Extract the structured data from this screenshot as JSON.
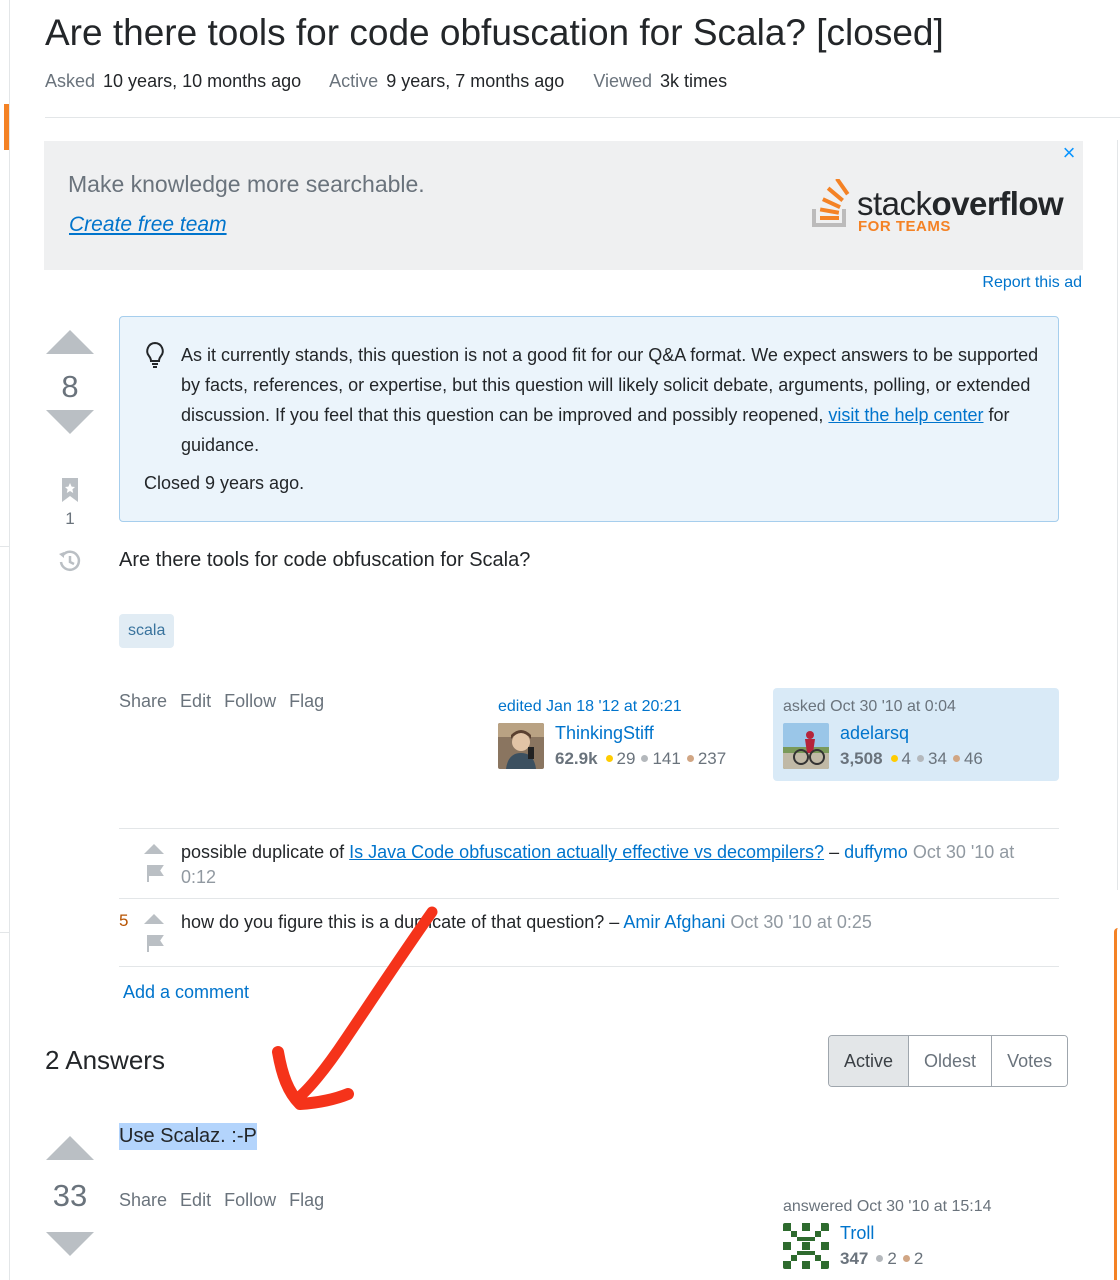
{
  "question": {
    "title": "Are there tools for code obfuscation for Scala? [closed]",
    "meta": {
      "asked_label": "Asked",
      "asked_value": "10 years, 10 months ago",
      "active_label": "Active",
      "active_value": "9 years, 7 months ago",
      "viewed_label": "Viewed",
      "viewed_value": "3k times"
    },
    "score": "8",
    "bookmark_count": "1",
    "body": "Are there tools for code obfuscation for Scala?",
    "tags": [
      "scala"
    ],
    "menu": {
      "share": "Share",
      "edit": "Edit",
      "follow": "Follow",
      "flag": "Flag"
    },
    "editor": {
      "action": "edited Jan 18 '12 at 20:21",
      "name": "ThinkingStiff",
      "rep": "62.9k",
      "gold": "29",
      "silver": "141",
      "bronze": "237"
    },
    "asker": {
      "action": "asked Oct 30 '10 at 0:04",
      "name": "adelarsq",
      "rep": "3,508",
      "gold": "4",
      "silver": "34",
      "bronze": "46"
    }
  },
  "ad": {
    "headline": "Make knowledge more searchable.",
    "link": "Create free team",
    "logo_light": "stack",
    "logo_bold": "overflow",
    "logo_sub": "FOR TEAMS",
    "close": "×",
    "report": "Report this ad"
  },
  "notice": {
    "text_before": "As it currently stands, this question is not a good fit for our Q&A format. We expect answers to be supported by facts, references, or expertise, but this question will likely solicit debate, arguments, polling, or extended discussion. If you feel that this question can be improved and possibly reopened,",
    "link": "visit the help center",
    "text_after": "for guidance.",
    "closed": "Closed 9 years ago."
  },
  "comments": {
    "items": [
      {
        "score": "",
        "text": "possible duplicate of",
        "link": "Is Java Code obfuscation actually effective vs decompilers?",
        "dash": "–",
        "user": "duffymo",
        "date": "Oct 30 '10 at 0:12"
      },
      {
        "score": "5",
        "text": "how do you figure this is a duplicate of that question?",
        "dash": "–",
        "user": "Amir Afghani",
        "date": "Oct 30 '10 at 0:25"
      }
    ],
    "add": "Add a comment"
  },
  "answers": {
    "heading": "2 Answers",
    "sort": [
      "Active",
      "Oldest",
      "Votes"
    ],
    "sort_active": "Active",
    "first": {
      "score": "33",
      "body": "Use Scalaz. :-P",
      "menu": {
        "share": "Share",
        "edit": "Edit",
        "follow": "Follow",
        "flag": "Flag"
      },
      "author": {
        "action": "answered Oct 30 '10 at 15:14",
        "name": "Troll",
        "rep": "347",
        "silver": "2",
        "bronze": "2"
      }
    }
  },
  "colors": {
    "link": "#0074cc",
    "accent": "#f48225",
    "notice_bg": "#ebf4fb",
    "owner_card_bg": "#d9eaf7",
    "annotation_arrow": "#f5331a"
  }
}
